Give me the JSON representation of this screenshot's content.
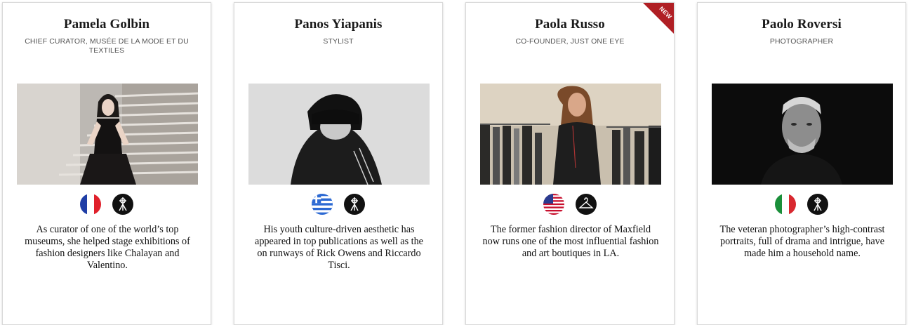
{
  "cards": [
    {
      "name": "Pamela Golbin",
      "role": "Chief Curator, Musée de la Mode et du Textiles",
      "flag_icon": "france-flag-icon",
      "category_icon": "camera-tripod-icon",
      "description": "As curator of one of the world’s top museums, she helped stage exhibitions of fashion designers like Chalayan and Valentino."
    },
    {
      "name": "Panos Yiapanis",
      "role": "Stylist",
      "flag_icon": "greece-flag-icon",
      "category_icon": "camera-tripod-icon",
      "description": "His youth culture-driven aesthetic has appeared in top publications as well as the on runways of Rick Owens and Riccardo Tisci."
    },
    {
      "name": "Paola Russo",
      "role": "Co-founder, Just One Eye",
      "flag_icon": "usa-flag-icon",
      "category_icon": "clothes-hanger-icon",
      "description": "The former fashion director of Maxfield now runs one of the most influential fashion and art boutiques in LA.",
      "badge": "NEW"
    },
    {
      "name": "Paolo Roversi",
      "role": "Photographer",
      "flag_icon": "italy-flag-icon",
      "category_icon": "camera-tripod-icon",
      "description": "The veteran photographer’s high-contrast portraits, full of drama and intrigue, have made him a household name."
    }
  ],
  "colors": {
    "badge": "#b01f24",
    "card_border": "#d9d9d9",
    "text": "#111111"
  }
}
